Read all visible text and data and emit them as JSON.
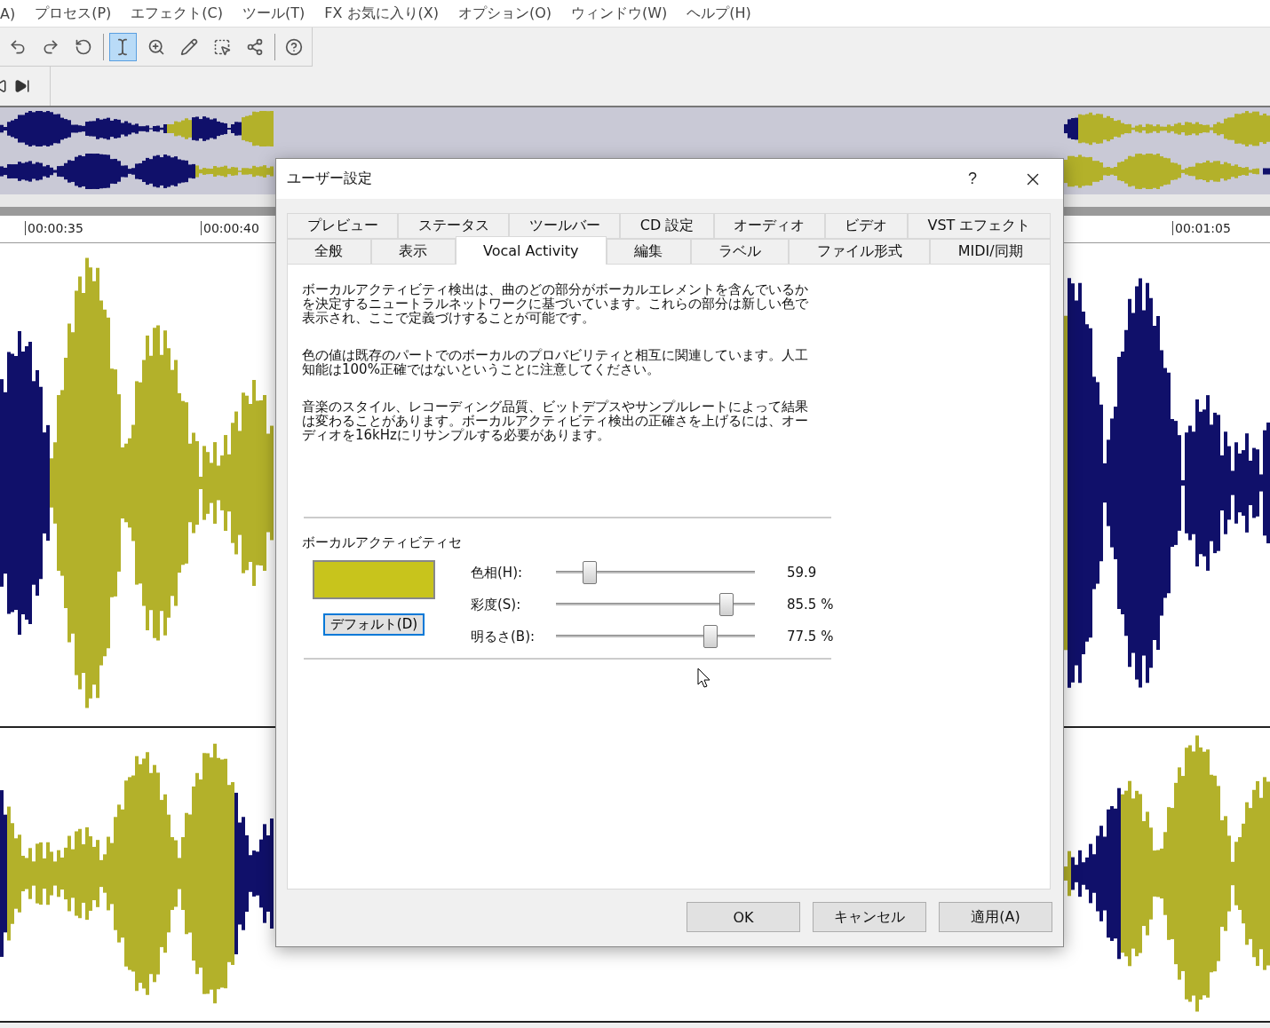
{
  "menu_bar": {
    "items": [
      "A)",
      "プロセス(P)",
      "エフェクト(C)",
      "ツール(T)",
      "FX お気に入り(X)",
      "オプション(O)",
      "ウィンドウ(W)",
      "ヘルプ(H)"
    ]
  },
  "toolbar": {
    "tools": [
      {
        "kind": "undo",
        "selected": false
      },
      {
        "kind": "redo",
        "selected": false
      },
      {
        "kind": "history",
        "selected": false
      },
      {
        "kind": "sep"
      },
      {
        "kind": "edit",
        "selected": true
      },
      {
        "kind": "zoom",
        "selected": false
      },
      {
        "kind": "pencil",
        "selected": false
      },
      {
        "kind": "select",
        "selected": false
      },
      {
        "kind": "envelope",
        "selected": false
      },
      {
        "kind": "sep"
      },
      {
        "kind": "help",
        "selected": false
      }
    ]
  },
  "ruler": {
    "labels": [
      "00:00:35",
      "00:00:40",
      "00:01:05"
    ]
  },
  "dialog": {
    "title": "ユーザー設定",
    "help": "?",
    "tab_rows": [
      [
        {
          "label": "プレビュー",
          "selected": false
        },
        {
          "label": "ステータス",
          "selected": false
        },
        {
          "label": "ツールバー",
          "selected": false
        },
        {
          "label": "CD 設定",
          "selected": false
        },
        {
          "label": "オーディオ",
          "selected": false
        },
        {
          "label": "ビデオ",
          "selected": false
        },
        {
          "label": "VST エフェクト",
          "selected": false
        }
      ],
      [
        {
          "label": "全般",
          "selected": false
        },
        {
          "label": "表示",
          "selected": false
        },
        {
          "label": "Vocal Activity",
          "selected": true
        },
        {
          "label": "編集",
          "selected": false
        },
        {
          "label": "ラベル",
          "selected": false
        },
        {
          "label": "ファイル形式",
          "selected": false
        },
        {
          "label": "MIDI/同期",
          "selected": false
        }
      ]
    ],
    "paragraphs": [
      "ボーカルアクティビティ検出は、曲のどの部分がボーカルエレメントを含んでいるかを決定するニュートラルネットワークに基づいています。これらの部分は新しい色で表示され、ここで定義づけすることが可能です。",
      "色の値は既存のパートでのボーカルのプロバビリティと相互に関連しています。人工知能は100%正確ではないということに注意してください。",
      "音楽のスタイル、レコーディング品質、ビットデプスやサンプルレートによって結果は変わることがあります。ボーカルアクティビティ検出の正確さを上げるには、オーディオを16kHzにリサンプルする必要があります。"
    ],
    "section_label": "ボーカルアクティビティセ",
    "swatch": {
      "color": "#c8c41c"
    },
    "default_button": "デフォルト(D)",
    "sliders": [
      {
        "label": "色相(H):",
        "level": 0.17,
        "reading": "59.9"
      },
      {
        "label": "彩度(S):",
        "level": 0.855,
        "reading": "85.5 %"
      },
      {
        "label": "明るさ(B):",
        "level": 0.775,
        "reading": "77.5 %"
      }
    ],
    "buttons": [
      "OK",
      "キャンセル",
      "適用(A)"
    ]
  }
}
